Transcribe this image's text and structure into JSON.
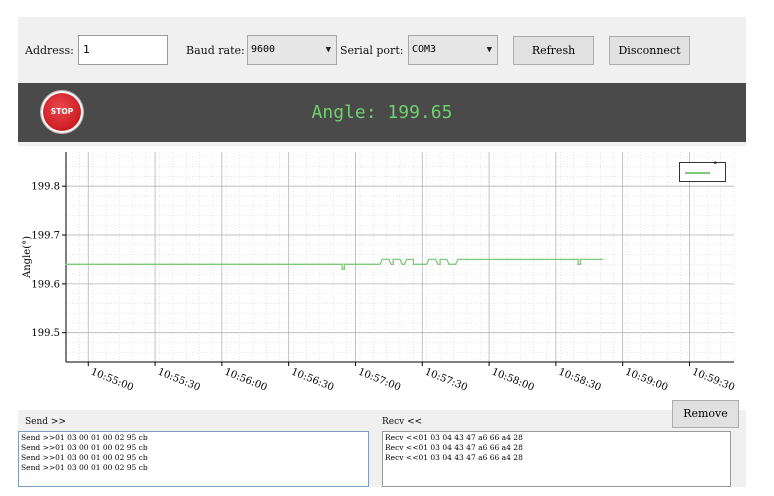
{
  "toolbar": {
    "address_label": "Address:",
    "address_value": "1",
    "baud_label": "Baud rate:",
    "baud_value": "9600",
    "port_label": "Serial port:",
    "port_value": "COM3",
    "refresh_label": "Refresh",
    "disconnect_label": "Disconnect"
  },
  "banner": {
    "stop_label": "STOP",
    "angle_text": "Angle: 199.65",
    "angle_color": "#6dd26b",
    "background": "#4a4a4a"
  },
  "chart_data": {
    "type": "line",
    "ylabel": "Angle(°)",
    "ylim": [
      199.44,
      199.87
    ],
    "yticks": [
      "199.5",
      "199.6",
      "199.7",
      "199.8"
    ],
    "ytick_values": [
      199.5,
      199.6,
      199.7,
      199.8
    ],
    "xlim": [
      "10:54:50",
      "10:59:50"
    ],
    "xticks": [
      "10:55:00",
      "10:55:30",
      "10:56:00",
      "10:56:30",
      "10:57:00",
      "10:57:30",
      "10:58:00",
      "10:58:30",
      "10:59:00",
      "10:59:30"
    ],
    "grid": true,
    "legend": {
      "position": "top-right",
      "entries": [
        "°"
      ]
    },
    "series": [
      {
        "name": "°",
        "color": "#7fc97a",
        "x": [
          "10:54:50",
          "10:56:54",
          "10:56:54",
          "10:56:55",
          "10:56:55",
          "10:57:11",
          "10:57:12",
          "10:57:15",
          "10:57:16",
          "10:57:17",
          "10:57:17",
          "10:57:20",
          "10:57:21",
          "10:57:22",
          "10:57:23",
          "10:57:26",
          "10:57:26",
          "10:57:32",
          "10:57:33",
          "10:57:36",
          "10:57:37",
          "10:57:38",
          "10:57:38",
          "10:57:41",
          "10:57:42",
          "10:57:45",
          "10:57:46",
          "10:58:08",
          "10:58:09",
          "10:58:40",
          "10:58:40",
          "10:58:41",
          "10:58:41",
          "10:58:51"
        ],
        "y": [
          199.64,
          199.64,
          199.63,
          199.63,
          199.64,
          199.64,
          199.65,
          199.65,
          199.64,
          199.64,
          199.65,
          199.65,
          199.64,
          199.64,
          199.65,
          199.65,
          199.64,
          199.64,
          199.65,
          199.65,
          199.64,
          199.64,
          199.65,
          199.65,
          199.64,
          199.64,
          199.65,
          199.65,
          199.65,
          199.65,
          199.64,
          199.64,
          199.65,
          199.65
        ]
      }
    ]
  },
  "bottom": {
    "remove_label": "Remove",
    "send_label": "Send >>",
    "recv_label": "Recv <<",
    "send_lines": [
      "Send >>01 03 00 01 00 02 95 cb",
      "Send >>01 03 00 01 00 02 95 cb",
      "Send >>01 03 00 01 00 02 95 cb",
      "Send >>01 03 00 01 00 02 95 cb"
    ],
    "recv_lines": [
      "Recv <<01 03 04 43 47 a6 66 a4 28",
      "Recv <<01 03 04 43 47 a6 66 a4 28",
      "Recv <<01 03 04 43 47 a6 66 a4 28"
    ]
  }
}
